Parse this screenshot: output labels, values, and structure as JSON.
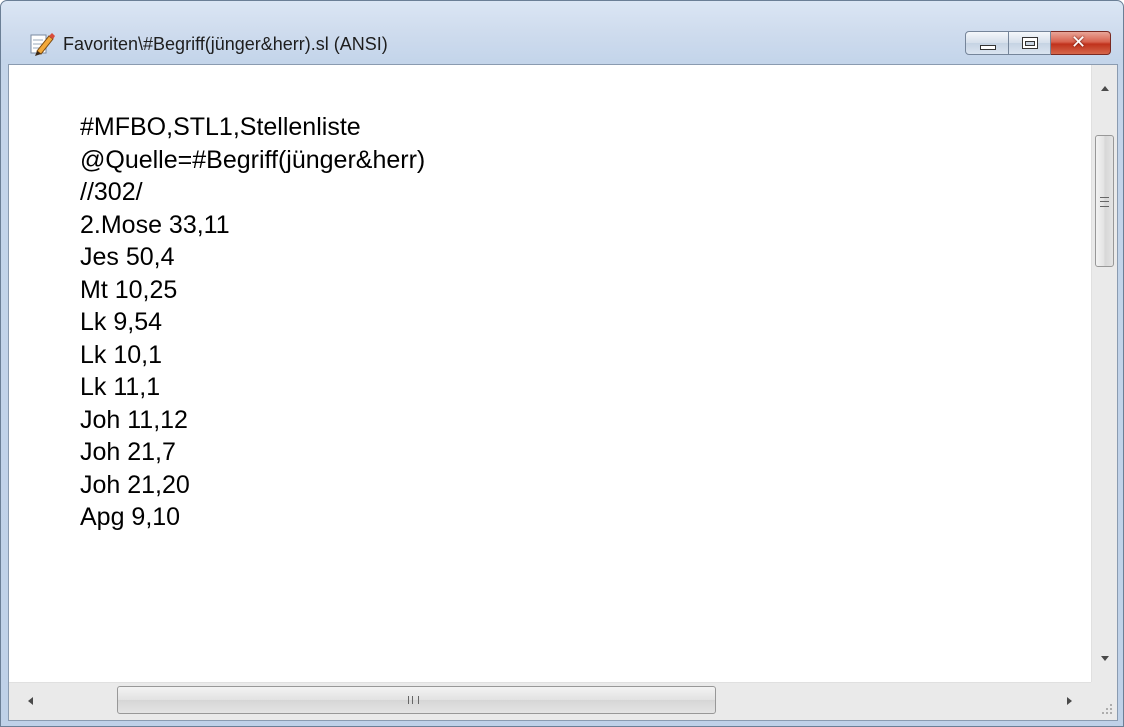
{
  "window": {
    "title": "Favoriten\\#Begriff(jünger&herr).sl (ANSI)",
    "icon": "pencil-icon",
    "buttons": [
      "minimize-icon",
      "maximize-icon",
      "close-icon"
    ],
    "close_color": "#c7432b"
  },
  "editor": {
    "lines": [
      "#MFBO,STL1,Stellenliste",
      "@Quelle=#Begriff(jünger&herr)",
      "//302/",
      "2.Mose 33,11",
      "Jes 50,4",
      "Mt 10,25",
      "Lk 9,54",
      "Lk 10,1",
      "Lk 11,1",
      "Joh 11,12",
      "Joh 21,7",
      "Joh 21,20",
      "Apg 9,10"
    ]
  },
  "scrollbars": {
    "vertical": {
      "position_fraction": 0.0
    },
    "horizontal": {
      "position_fraction": 0.0
    }
  }
}
